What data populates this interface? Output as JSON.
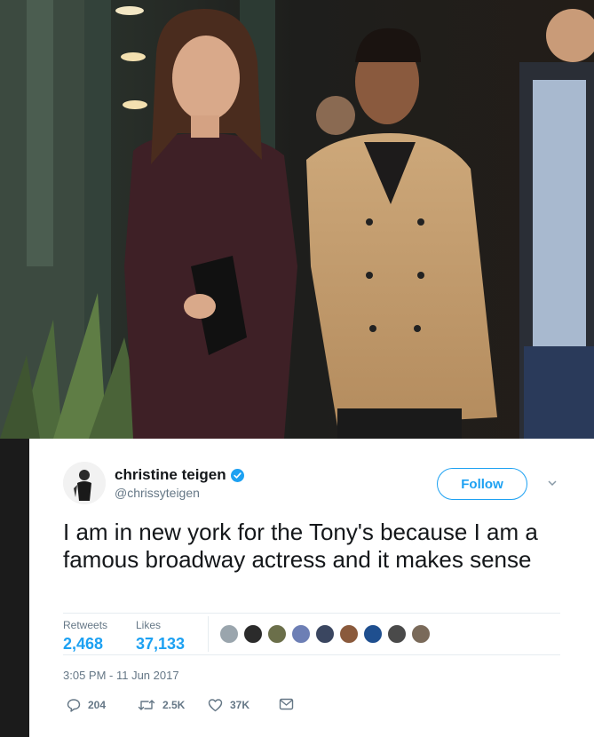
{
  "tweet": {
    "author_name": "christine teigen",
    "handle": "@chrissyteigen",
    "follow_label": "Follow",
    "text": "I am in new york for the Tony's because I am a famous broadway actress and it makes sense",
    "timestamp": "3:05 PM - 11 Jun 2017"
  },
  "stats": {
    "retweets_label": "Retweets",
    "retweets_value": "2,468",
    "likes_label": "Likes",
    "likes_value": "37,133"
  },
  "likers": [
    {
      "color": "#9aa5ad"
    },
    {
      "color": "#2b2b2b"
    },
    {
      "color": "#6b6f4a"
    },
    {
      "color": "#6d7fb5"
    },
    {
      "color": "#3a4660"
    },
    {
      "color": "#8a5a3c"
    },
    {
      "color": "#1f4f8f"
    },
    {
      "color": "#4a4a4a"
    },
    {
      "color": "#7a6a5a"
    }
  ],
  "actions": {
    "replies": "204",
    "retweets": "2.5K",
    "likes": "37K"
  },
  "icons": {
    "verified": "verified-badge-icon",
    "caret": "chevron-down-icon",
    "reply": "reply-icon",
    "retweet": "retweet-icon",
    "like": "heart-icon",
    "dm": "envelope-icon"
  },
  "colors": {
    "accent": "#1da1f2",
    "muted": "#657786",
    "text": "#14171a"
  }
}
